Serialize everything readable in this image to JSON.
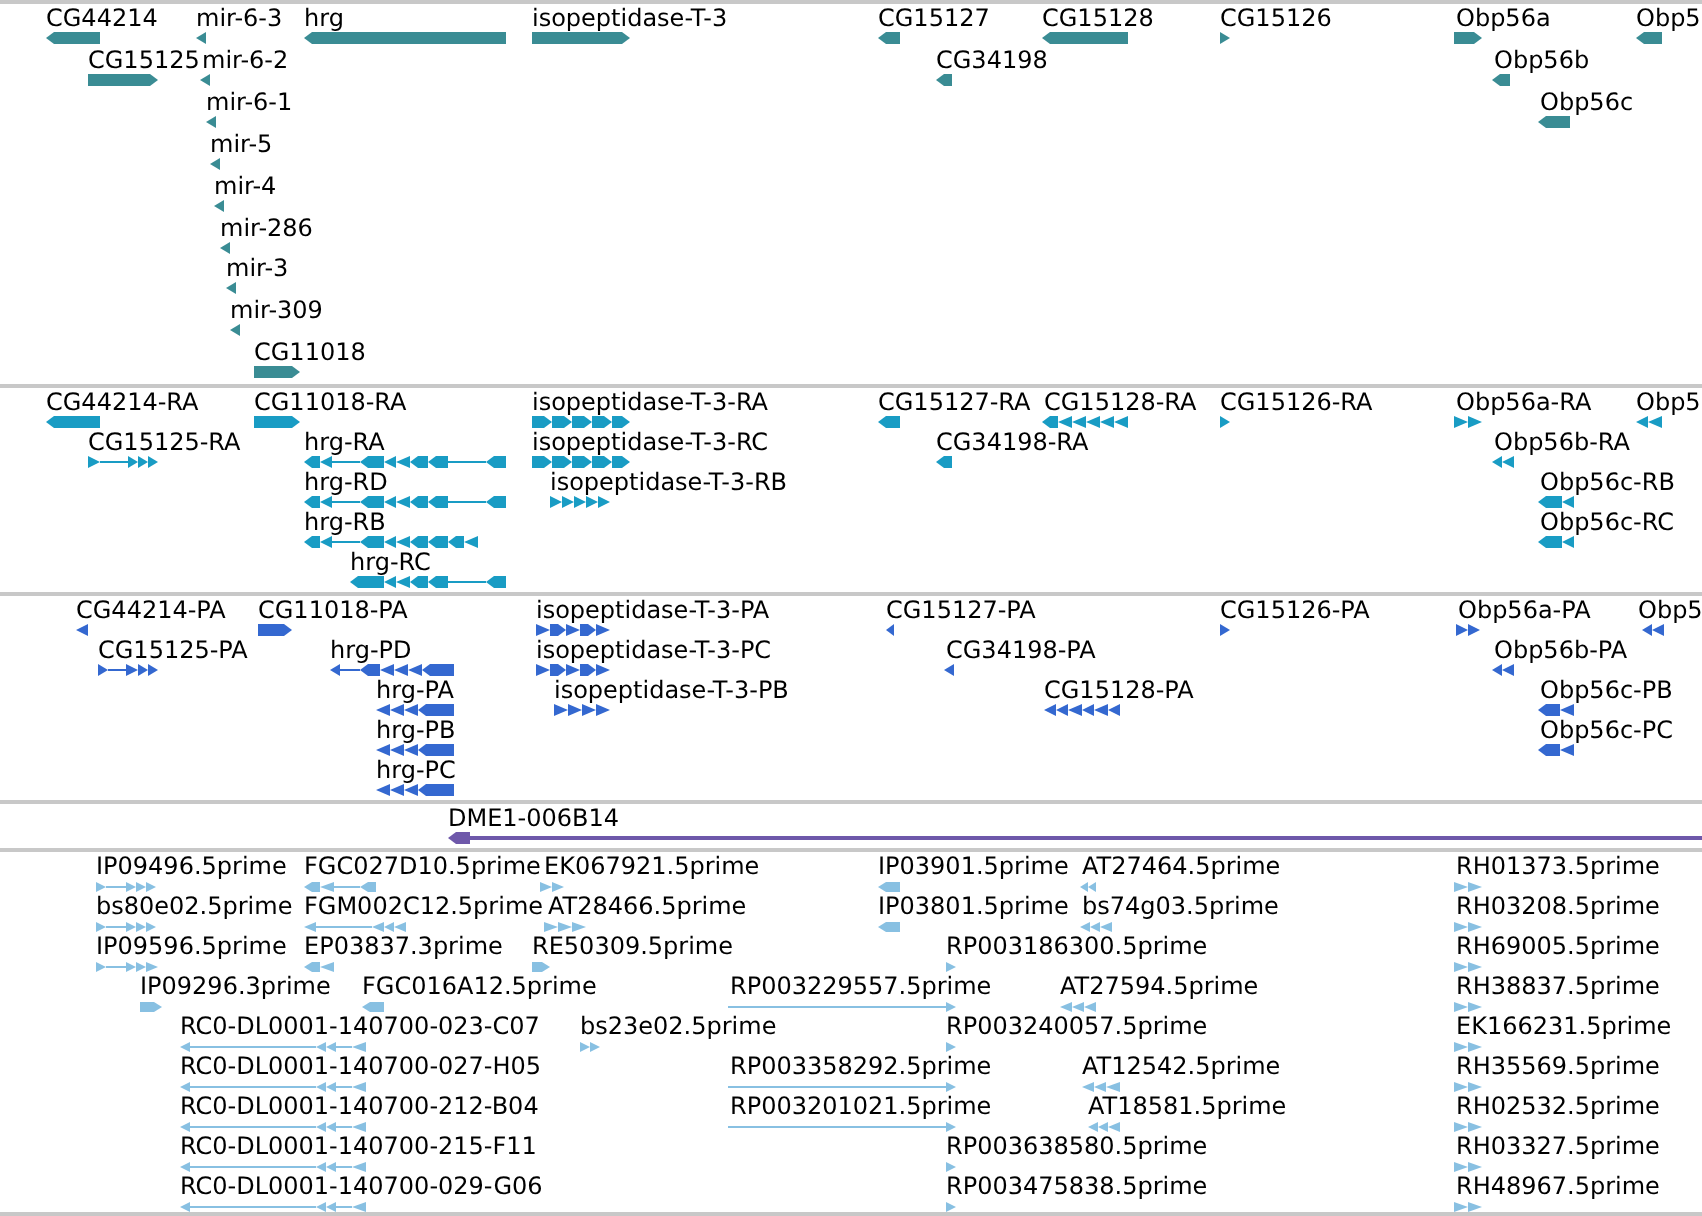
{
  "tracks": [
    {
      "color": "#3a8c94",
      "features": [
        {
          "label": "CG44214",
          "reverse": true
        },
        {
          "label": "mir-6-3",
          "reverse": true
        },
        {
          "label": "hrg",
          "reverse": true
        },
        {
          "label": "isopeptidase-T-3",
          "reverse": false
        },
        {
          "label": "CG15127",
          "reverse": true
        },
        {
          "label": "CG15128",
          "reverse": true
        },
        {
          "label": "CG15126",
          "reverse": false
        },
        {
          "label": "Obp56a",
          "reverse": false
        },
        {
          "label": "Obp5",
          "reverse": true
        },
        {
          "label": "CG15125",
          "reverse": false
        },
        {
          "label": "mir-6-2",
          "reverse": true
        },
        {
          "label": "CG34198",
          "reverse": true
        },
        {
          "label": "Obp56b",
          "reverse": true
        },
        {
          "label": "mir-6-1",
          "reverse": true
        },
        {
          "label": "Obp56c",
          "reverse": true
        },
        {
          "label": "mir-5",
          "reverse": true
        },
        {
          "label": "mir-4",
          "reverse": true
        },
        {
          "label": "mir-286",
          "reverse": true
        },
        {
          "label": "mir-3",
          "reverse": true
        },
        {
          "label": "mir-309",
          "reverse": true
        },
        {
          "label": "CG11018",
          "reverse": false
        }
      ]
    },
    {
      "color": "#199cc4",
      "features": [
        {
          "label": "CG44214-RA",
          "reverse": true
        },
        {
          "label": "CG11018-RA",
          "reverse": false
        },
        {
          "label": "isopeptidase-T-3-RA",
          "reverse": false
        },
        {
          "label": "CG15127-RA",
          "reverse": true
        },
        {
          "label": "CG15128-RA",
          "reverse": true
        },
        {
          "label": "CG15126-RA",
          "reverse": false
        },
        {
          "label": "Obp56a-RA",
          "reverse": false
        },
        {
          "label": "Obp5",
          "reverse": true
        },
        {
          "label": "CG15125-RA",
          "reverse": false
        },
        {
          "label": "hrg-RA",
          "reverse": true
        },
        {
          "label": "isopeptidase-T-3-RC",
          "reverse": false
        },
        {
          "label": "CG34198-RA",
          "reverse": true
        },
        {
          "label": "Obp56b-RA",
          "reverse": true
        },
        {
          "label": "hrg-RD",
          "reverse": true
        },
        {
          "label": "isopeptidase-T-3-RB",
          "reverse": false
        },
        {
          "label": "Obp56c-RB",
          "reverse": true
        },
        {
          "label": "hrg-RB",
          "reverse": true
        },
        {
          "label": "Obp56c-RC",
          "reverse": true
        },
        {
          "label": "hrg-RC",
          "reverse": true
        }
      ]
    },
    {
      "color": "#3468d0",
      "features": [
        {
          "label": "CG44214-PA",
          "reverse": true
        },
        {
          "label": "CG11018-PA",
          "reverse": false
        },
        {
          "label": "isopeptidase-T-3-PA",
          "reverse": false
        },
        {
          "label": "CG15127-PA",
          "reverse": true
        },
        {
          "label": "CG15126-PA",
          "reverse": false
        },
        {
          "label": "Obp56a-PA",
          "reverse": false
        },
        {
          "label": "Obp5",
          "reverse": true
        },
        {
          "label": "CG15125-PA",
          "reverse": false
        },
        {
          "label": "hrg-PD",
          "reverse": true
        },
        {
          "label": "isopeptidase-T-3-PC",
          "reverse": false
        },
        {
          "label": "CG34198-PA",
          "reverse": true
        },
        {
          "label": "Obp56b-PA",
          "reverse": true
        },
        {
          "label": "hrg-PA",
          "reverse": true
        },
        {
          "label": "isopeptidase-T-3-PB",
          "reverse": false
        },
        {
          "label": "CG15128-PA",
          "reverse": true
        },
        {
          "label": "Obp56c-PB",
          "reverse": true
        },
        {
          "label": "hrg-PB",
          "reverse": true
        },
        {
          "label": "Obp56c-PC",
          "reverse": true
        },
        {
          "label": "hrg-PC",
          "reverse": true
        }
      ]
    },
    {
      "color": "#6e58aa",
      "features": [
        {
          "label": "DME1-006B14",
          "reverse": true
        }
      ]
    },
    {
      "color": "#88c0e2",
      "features": [
        {
          "label": "IP09496.5prime",
          "reverse": false
        },
        {
          "label": "FGC027D10.5prime",
          "reverse": true
        },
        {
          "label": "EK067921.5prime",
          "reverse": false
        },
        {
          "label": "IP03901.5prime",
          "reverse": true
        },
        {
          "label": "AT27464.5prime",
          "reverse": true
        },
        {
          "label": "RH01373.5prime",
          "reverse": false
        },
        {
          "label": "bs80e02.5prime",
          "reverse": false
        },
        {
          "label": "FGM002C12.5prime",
          "reverse": true
        },
        {
          "label": "AT28466.5prime",
          "reverse": false
        },
        {
          "label": "IP03801.5prime",
          "reverse": true
        },
        {
          "label": "bs74g03.5prime",
          "reverse": true
        },
        {
          "label": "RH03208.5prime",
          "reverse": false
        },
        {
          "label": "IP09596.5prime",
          "reverse": false
        },
        {
          "label": "EP03837.3prime",
          "reverse": true
        },
        {
          "label": "RE50309.5prime",
          "reverse": false
        },
        {
          "label": "RP003186300.5prime",
          "reverse": false
        },
        {
          "label": "RH69005.5prime",
          "reverse": false
        },
        {
          "label": "IP09296.3prime",
          "reverse": false
        },
        {
          "label": "FGC016A12.5prime",
          "reverse": true
        },
        {
          "label": "RP003229557.5prime",
          "reverse": false
        },
        {
          "label": "AT27594.5prime",
          "reverse": true
        },
        {
          "label": "RH38837.5prime",
          "reverse": false
        },
        {
          "label": "RC0-DL0001-140700-023-C07",
          "reverse": true
        },
        {
          "label": "bs23e02.5prime",
          "reverse": false
        },
        {
          "label": "RP003240057.5prime",
          "reverse": false
        },
        {
          "label": "EK166231.5prime",
          "reverse": false
        },
        {
          "label": "RC0-DL0001-140700-027-H05",
          "reverse": true
        },
        {
          "label": "RP003358292.5prime",
          "reverse": false
        },
        {
          "label": "AT12542.5prime",
          "reverse": true
        },
        {
          "label": "RH35569.5prime",
          "reverse": false
        },
        {
          "label": "RC0-DL0001-140700-212-B04",
          "reverse": true
        },
        {
          "label": "RP003201021.5prime",
          "reverse": false
        },
        {
          "label": "AT18581.5prime",
          "reverse": true
        },
        {
          "label": "RH02532.5prime",
          "reverse": false
        },
        {
          "label": "RC0-DL0001-140700-215-F11",
          "reverse": true
        },
        {
          "label": "RP003638580.5prime",
          "reverse": false
        },
        {
          "label": "RH03327.5prime",
          "reverse": false
        },
        {
          "label": "RC0-DL0001-140700-029-G06",
          "reverse": true
        },
        {
          "label": "RP003475838.5prime",
          "reverse": false
        },
        {
          "label": "RH48967.5prime",
          "reverse": false
        }
      ]
    }
  ]
}
